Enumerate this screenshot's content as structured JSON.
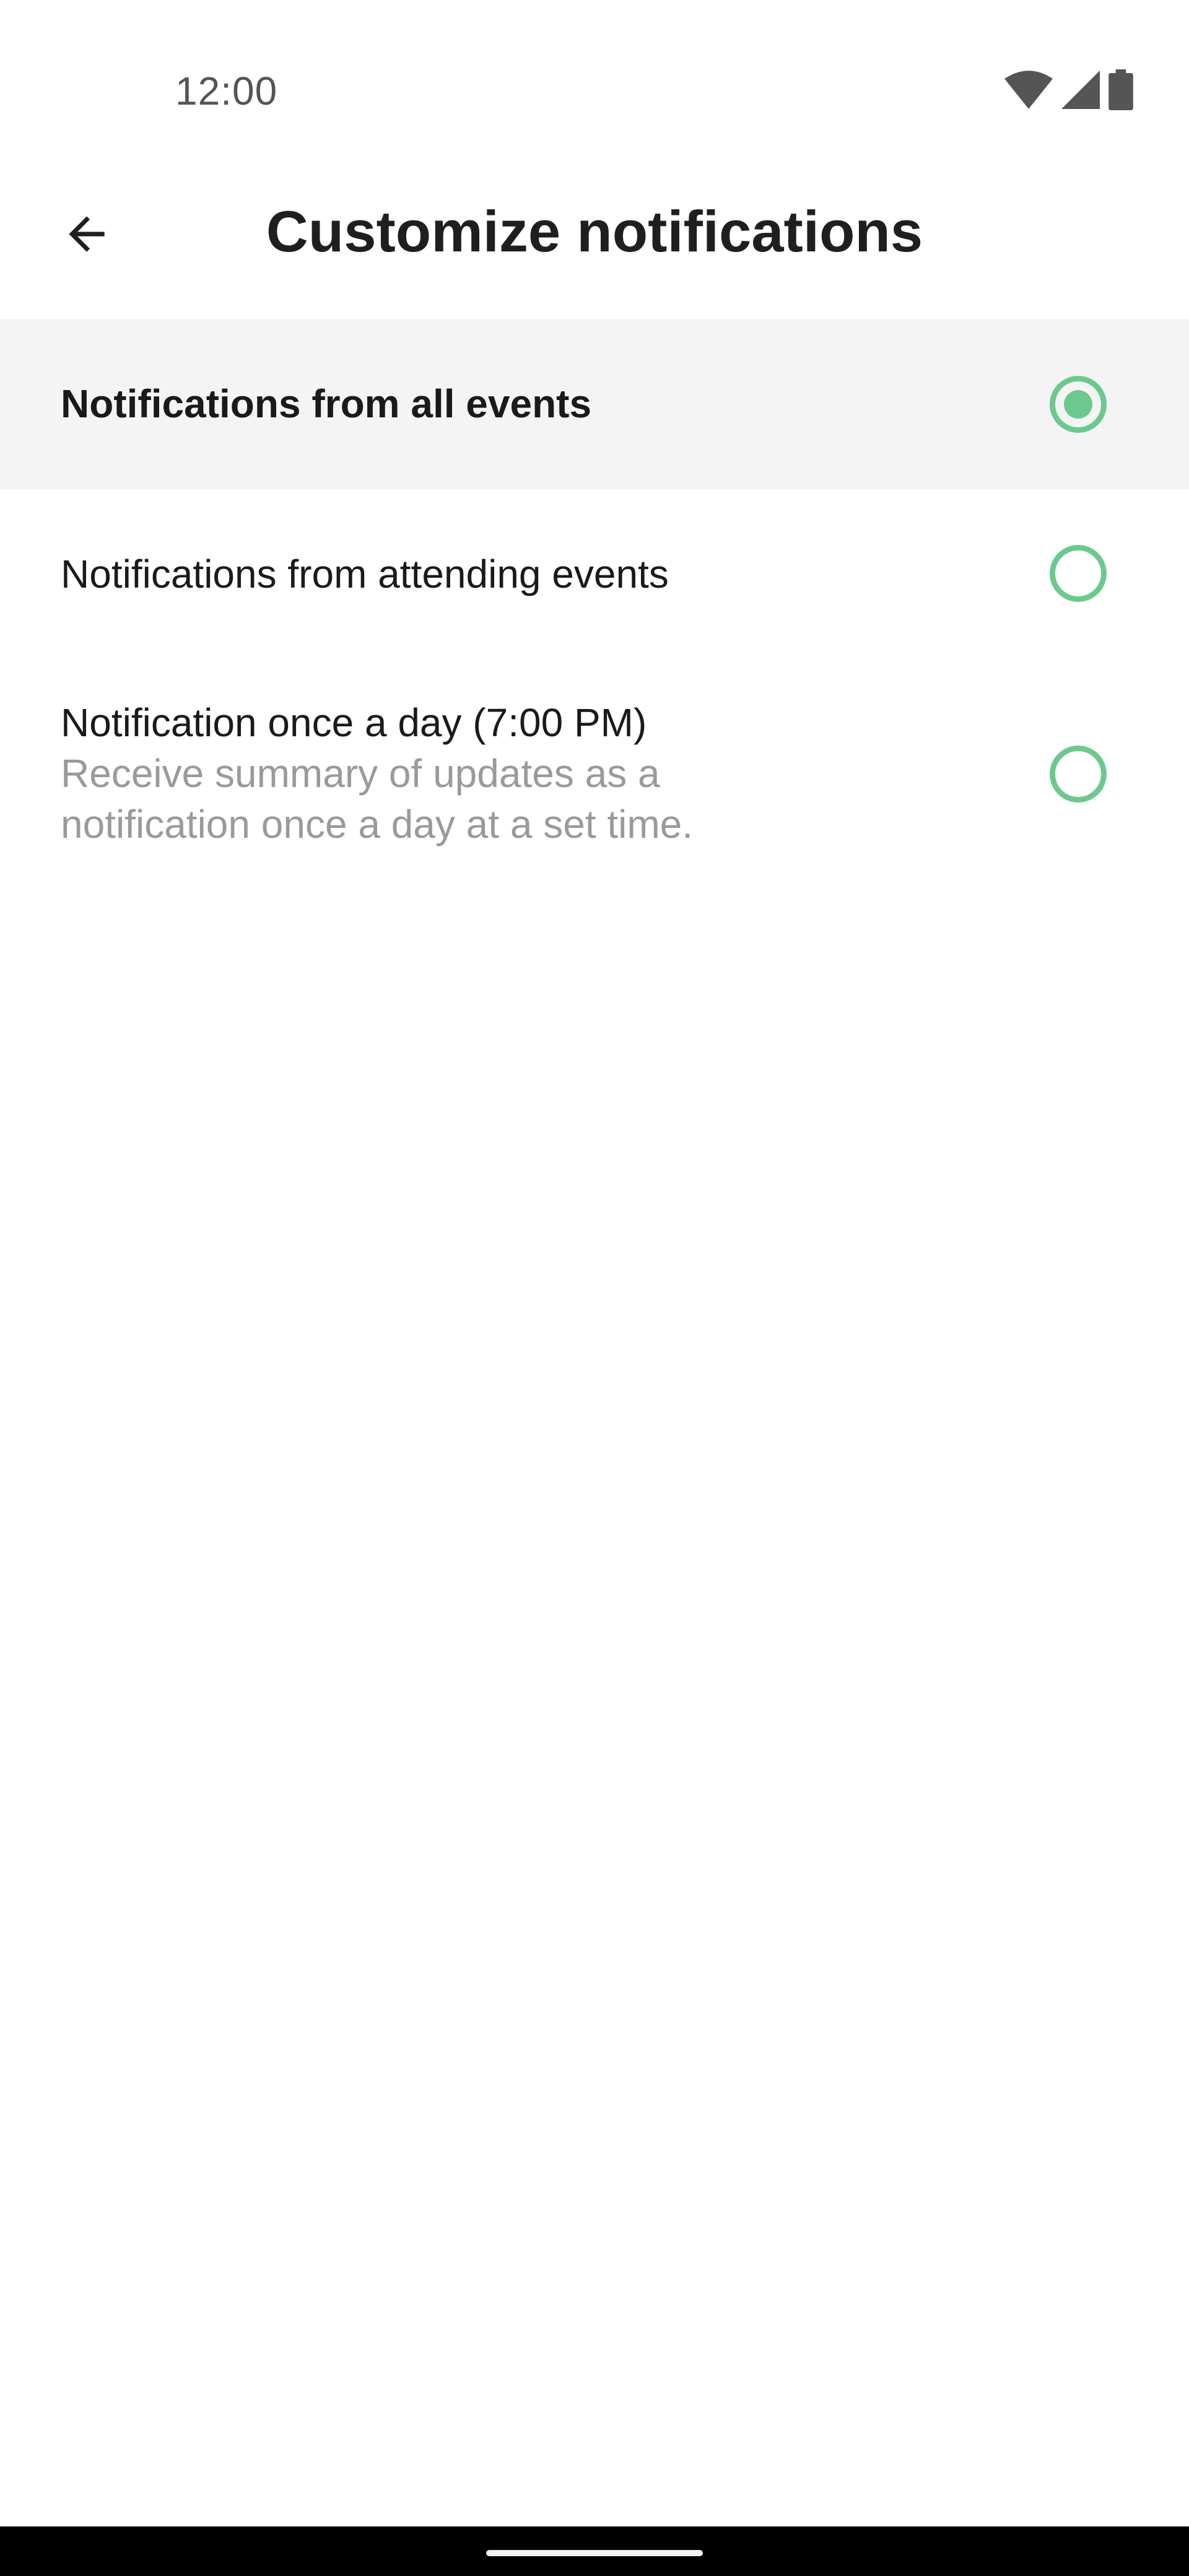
{
  "status_bar": {
    "time": "12:00",
    "icons": [
      "wifi-icon",
      "cellular-signal-icon",
      "battery-icon"
    ]
  },
  "app_bar": {
    "back_icon": "arrow-back-icon",
    "title": "Customize notifications"
  },
  "options": [
    {
      "title": "Notifications from all events",
      "selected": true
    },
    {
      "title": "Notifications from attending events",
      "selected": false
    },
    {
      "title": "Notification once a day (7:00 PM)",
      "description": "Receive summary of updates as a notification once a day at a set time.",
      "selected": false
    }
  ],
  "colors": {
    "accent": "#6cc98e",
    "selected_row_bg": "#f4f4f4",
    "title_text": "#1f1f1f",
    "secondary_text": "#9a9a9a"
  }
}
